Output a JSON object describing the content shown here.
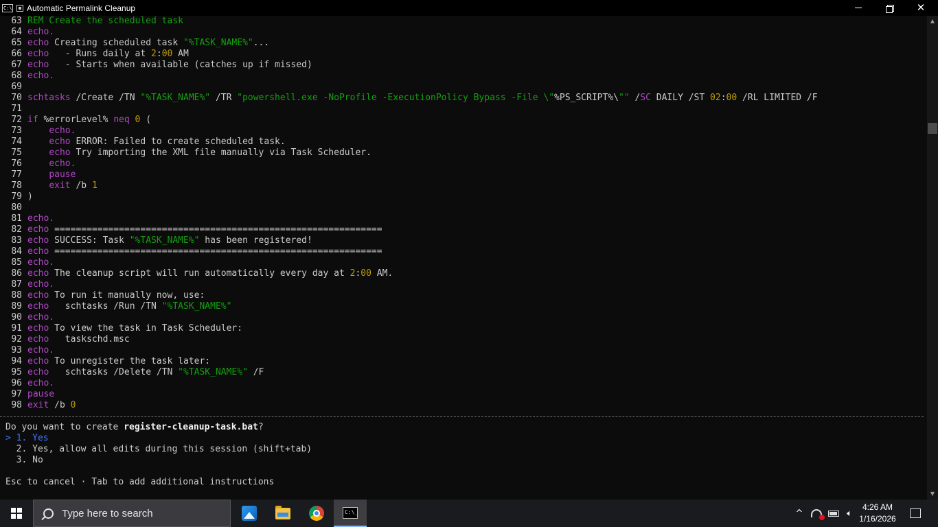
{
  "window": {
    "title": "Automatic Permalink Cleanup",
    "icon_text": "C:\\",
    "controls": {
      "minimize": "minimize-icon",
      "maximize": "restore-icon",
      "close": "✕"
    }
  },
  "code_lines": [
    [
      {
        "t": "cmt",
        "v": "REM Create the scheduled task"
      }
    ],
    [
      {
        "t": "kw",
        "v": "echo."
      }
    ],
    [
      {
        "t": "kw",
        "v": "echo"
      },
      {
        "t": "",
        "v": " Creating scheduled task "
      },
      {
        "t": "str",
        "v": "\"%TASK_NAME%\""
      },
      {
        "t": "",
        "v": "..."
      }
    ],
    [
      {
        "t": "kw",
        "v": "echo"
      },
      {
        "t": "",
        "v": "   - Runs daily at "
      },
      {
        "t": "num",
        "v": "2"
      },
      {
        "t": "",
        "v": ":"
      },
      {
        "t": "num",
        "v": "00"
      },
      {
        "t": "",
        "v": " AM"
      }
    ],
    [
      {
        "t": "kw",
        "v": "echo"
      },
      {
        "t": "",
        "v": "   - Starts when available (catches up if missed)"
      }
    ],
    [
      {
        "t": "kw",
        "v": "echo."
      }
    ],
    [],
    [
      {
        "t": "kw",
        "v": "schtasks"
      },
      {
        "t": "",
        "v": " /Create /TN "
      },
      {
        "t": "str",
        "v": "\"%TASK_NAME%\""
      },
      {
        "t": "",
        "v": " /TR "
      },
      {
        "t": "str",
        "v": "\"powershell.exe -NoProfile -ExecutionPolicy Bypass -File \\\""
      },
      {
        "t": "",
        "v": "%PS_SCRIPT%\\"
      },
      {
        "t": "str",
        "v": "\"\""
      },
      {
        "t": "",
        "v": " /"
      },
      {
        "t": "kw",
        "v": "SC"
      },
      {
        "t": "",
        "v": " DAILY /ST "
      },
      {
        "t": "num",
        "v": "02"
      },
      {
        "t": "",
        "v": ":"
      },
      {
        "t": "num",
        "v": "00"
      },
      {
        "t": "",
        "v": " /RL LIMITED /F"
      }
    ],
    [],
    [
      {
        "t": "kw",
        "v": "if"
      },
      {
        "t": "",
        "v": " %errorLevel% "
      },
      {
        "t": "kw",
        "v": "neq"
      },
      {
        "t": "",
        "v": " "
      },
      {
        "t": "num",
        "v": "0"
      },
      {
        "t": "",
        "v": " ("
      }
    ],
    [
      {
        "t": "",
        "v": "    "
      },
      {
        "t": "kw",
        "v": "echo."
      }
    ],
    [
      {
        "t": "",
        "v": "    "
      },
      {
        "t": "kw",
        "v": "echo"
      },
      {
        "t": "",
        "v": " ERROR: Failed to create scheduled task."
      }
    ],
    [
      {
        "t": "",
        "v": "    "
      },
      {
        "t": "kw",
        "v": "echo"
      },
      {
        "t": "",
        "v": " Try importing the XML file manually via Task Scheduler."
      }
    ],
    [
      {
        "t": "",
        "v": "    "
      },
      {
        "t": "kw",
        "v": "echo."
      }
    ],
    [
      {
        "t": "",
        "v": "    "
      },
      {
        "t": "kw",
        "v": "pause"
      }
    ],
    [
      {
        "t": "",
        "v": "    "
      },
      {
        "t": "kw",
        "v": "exit"
      },
      {
        "t": "",
        "v": " /b "
      },
      {
        "t": "num",
        "v": "1"
      }
    ],
    [
      {
        "t": "",
        "v": ")"
      }
    ],
    [],
    [
      {
        "t": "kw",
        "v": "echo."
      }
    ],
    [
      {
        "t": "kw",
        "v": "echo"
      },
      {
        "t": "",
        "v": " ============================================================="
      }
    ],
    [
      {
        "t": "kw",
        "v": "echo"
      },
      {
        "t": "",
        "v": " SUCCESS: Task "
      },
      {
        "t": "str",
        "v": "\"%TASK_NAME%\""
      },
      {
        "t": "",
        "v": " has been registered!"
      }
    ],
    [
      {
        "t": "kw",
        "v": "echo"
      },
      {
        "t": "",
        "v": " ============================================================="
      }
    ],
    [
      {
        "t": "kw",
        "v": "echo."
      }
    ],
    [
      {
        "t": "kw",
        "v": "echo"
      },
      {
        "t": "",
        "v": " The cleanup script will run automatically every day at "
      },
      {
        "t": "num",
        "v": "2"
      },
      {
        "t": "",
        "v": ":"
      },
      {
        "t": "num",
        "v": "00"
      },
      {
        "t": "",
        "v": " AM."
      }
    ],
    [
      {
        "t": "kw",
        "v": "echo."
      }
    ],
    [
      {
        "t": "kw",
        "v": "echo"
      },
      {
        "t": "",
        "v": " To run it manually now, use:"
      }
    ],
    [
      {
        "t": "kw",
        "v": "echo"
      },
      {
        "t": "",
        "v": "   schtasks /Run /TN "
      },
      {
        "t": "str",
        "v": "\"%TASK_NAME%\""
      }
    ],
    [
      {
        "t": "kw",
        "v": "echo."
      }
    ],
    [
      {
        "t": "kw",
        "v": "echo"
      },
      {
        "t": "",
        "v": " To view the task in Task Scheduler:"
      }
    ],
    [
      {
        "t": "kw",
        "v": "echo"
      },
      {
        "t": "",
        "v": "   taskschd.msc"
      }
    ],
    [
      {
        "t": "kw",
        "v": "echo."
      }
    ],
    [
      {
        "t": "kw",
        "v": "echo"
      },
      {
        "t": "",
        "v": " To unregister the task later:"
      }
    ],
    [
      {
        "t": "kw",
        "v": "echo"
      },
      {
        "t": "",
        "v": "   schtasks /Delete /TN "
      },
      {
        "t": "str",
        "v": "\"%TASK_NAME%\""
      },
      {
        "t": "",
        "v": " /F"
      }
    ],
    [
      {
        "t": "kw",
        "v": "echo."
      }
    ],
    [
      {
        "t": "kw",
        "v": "pause"
      }
    ],
    [
      {
        "t": "kw",
        "v": "exit"
      },
      {
        "t": "",
        "v": " /b "
      },
      {
        "t": "num",
        "v": "0"
      }
    ]
  ],
  "first_line_number": 63,
  "prompt": {
    "question_prefix": "Do you want to create ",
    "file_name": "register-cleanup-task.bat",
    "question_suffix": "?",
    "cursor": ">",
    "options": [
      {
        "number": "1.",
        "label": "Yes",
        "selected": true
      },
      {
        "number": "2.",
        "label": "Yes, allow all edits during this session (shift+tab)",
        "selected": false
      },
      {
        "number": "3.",
        "label": "No",
        "selected": false
      }
    ],
    "hint": "Esc to cancel · Tab to add additional instructions"
  },
  "taskbar": {
    "search_placeholder": "Type here to search",
    "apps": [
      "photos-icon",
      "file-explorer-icon",
      "chrome-icon",
      "command-prompt-icon"
    ],
    "active_app": "command-prompt-icon",
    "tray_chevron": "^",
    "clock_time": "4:26 AM",
    "clock_date": "1/16/2026"
  },
  "colors": {
    "keyword": "#b148c6",
    "string": "#13a10e",
    "number": "#c19c00",
    "text": "#cccccc",
    "selected": "#3b78ff",
    "background": "#0c0c0c"
  }
}
